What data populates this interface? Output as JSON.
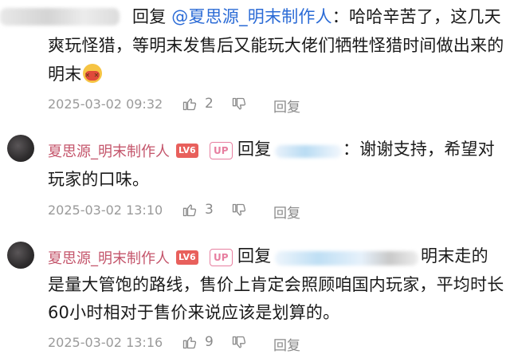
{
  "comments": [
    {
      "reply_word": "回复",
      "mention": "@夏思源_明末制作人",
      "text_line1": "：哈哈辛苦了，这几天",
      "text_line2": "爽玩怪猎，等明末发售后又能玩大佬们牺牲怪猎时间做出来的",
      "text_line3": "明末",
      "emoji_icon": "angry-face-emoji",
      "timestamp": "2025-03-02 09:32",
      "likes": "2",
      "reply_label": "回复"
    },
    {
      "username": "夏思源_明末制作人",
      "level": "LV6",
      "badge": "UP",
      "reply_word": "回复",
      "text_line1": "：谢谢支持，希望对",
      "text_line2": "玩家的口味。",
      "timestamp": "2025-03-02 13:10",
      "likes": "3",
      "reply_label": "回复"
    },
    {
      "username": "夏思源_明末制作人",
      "level": "LV6",
      "badge": "UP",
      "reply_word": "回复",
      "text_line1": "明末走的",
      "text_line2": "是量大管饱的路线，售价上肯定会照顾咱国内玩家，平均时长",
      "text_line3": "60小时相对于售价来说应该是划算的。",
      "timestamp": "2025-03-02 13:16",
      "likes": "9",
      "reply_label": "回复"
    }
  ],
  "colors": {
    "mention": "#2b6bd6",
    "username": "#c4556b",
    "level_badge": "#e8605c",
    "up_badge": "#e77fa0",
    "meta": "#9a9a9a"
  }
}
